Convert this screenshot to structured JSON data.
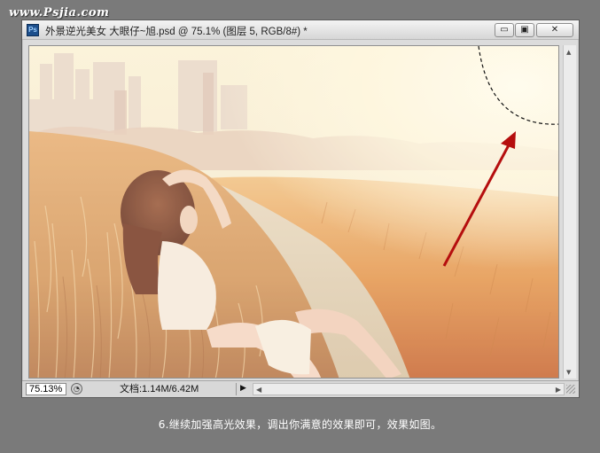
{
  "watermark": "www.Psjia.com",
  "window": {
    "app_icon": "Ps",
    "title": "外景逆光美女  大眼仔~旭.psd @ 75.1% (图层 5, RGB/8#) *",
    "controls": {
      "minimize": "▭",
      "maximize": "▣",
      "close": "✕"
    }
  },
  "status": {
    "zoom": "75.13%",
    "doc_label": "文档:1.14M/6.42M"
  },
  "caption": "6.继续加强高光效果，调出你满意的效果即可，效果如图。",
  "colors": {
    "background": "#7a7a7a",
    "arrow": "#b50e0e",
    "sky": "#fdf6d8",
    "field": "#e9a55b"
  }
}
